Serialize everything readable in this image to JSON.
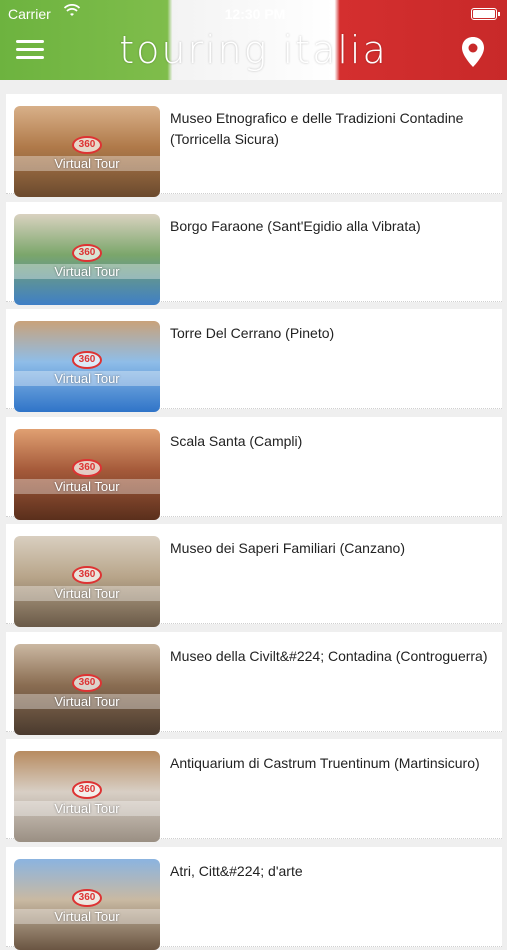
{
  "status": {
    "carrier": "Carrier",
    "time": "12:30 PM"
  },
  "header": {
    "title": "Touring Italia",
    "colors": {
      "left": "#6db33f",
      "middle": "#ffffff",
      "right": "#d42f2f"
    }
  },
  "icons": {
    "menu": "hamburger-icon",
    "location": "map-pin-icon",
    "wifi": "wifi-icon",
    "battery": "battery-icon"
  },
  "thumb_badge": {
    "logo": "360",
    "label": "Virtual Tour"
  },
  "items": [
    {
      "title": "Museo Etnografico e delle Tradizioni Contadine (Torricella Sicura)",
      "palette": [
        "#6b4a2e",
        "#b07a4a",
        "#d8b089"
      ]
    },
    {
      "title": "Borgo Faraone (Sant'Egidio alla Vibrata)",
      "palette": [
        "#3f7fc6",
        "#7ba66b",
        "#d9d2c0"
      ]
    },
    {
      "title": "Torre Del Cerrano (Pineto)",
      "palette": [
        "#2f74c8",
        "#8fbde8",
        "#c9a27a"
      ]
    },
    {
      "title": "Scala Santa (Campli)",
      "palette": [
        "#5a2f1c",
        "#a55a3a",
        "#e0a072"
      ]
    },
    {
      "title": "Museo dei Saperi Familiari (Canzano)",
      "palette": [
        "#6a5a48",
        "#b8a58a",
        "#d9cfc0"
      ]
    },
    {
      "title": "Museo della Civilt&#224; Contadina (Controguerra)",
      "palette": [
        "#4a3a2e",
        "#8a6d52",
        "#cbb8a2"
      ]
    },
    {
      "title": "Antiquarium di Castrum Truentinum (Martinsicuro)",
      "palette": [
        "#9a8f83",
        "#d8cfc5",
        "#b78b60"
      ]
    },
    {
      "title": "Atri, Citt&#224; d'arte",
      "palette": [
        "#6a5542",
        "#c9b9a2",
        "#8bb4e0"
      ]
    }
  ]
}
